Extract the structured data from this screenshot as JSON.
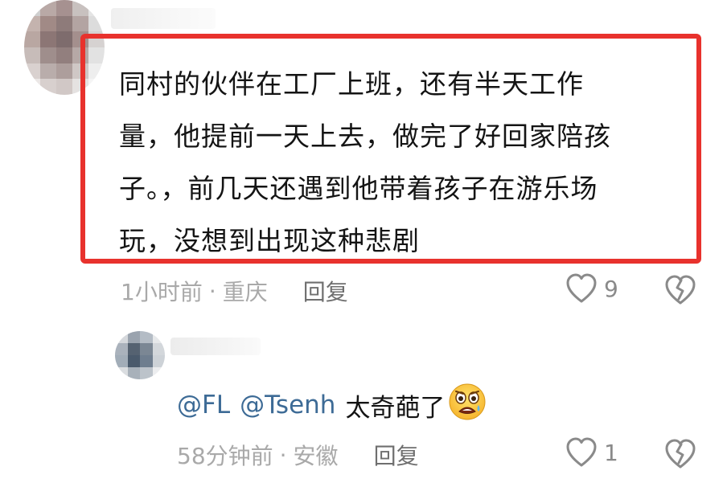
{
  "comment": {
    "lines": [
      "同村的伙伴在工厂上班，还有半天工作",
      "量，他提前一天上去，做完了好回家陪孩",
      "子。，前几天还遇到他带着孩子在游乐场",
      "玩，没想到出现这种悲剧"
    ],
    "time": "1小时前",
    "separator": "·",
    "location": "重庆",
    "reply_label": "回复",
    "like_count": "9",
    "highlight_color": "#e8322d"
  },
  "reply": {
    "mentions": [
      "@FL",
      "@Tsenh"
    ],
    "text": "太奇葩了",
    "emoji": "distressed-face-emoji",
    "time": "58分钟前",
    "separator": "·",
    "location": "安徽",
    "reply_label": "回复",
    "like_count": "1",
    "mention_color": "#3d6b96"
  },
  "icons": {
    "like": "heart-outline-icon",
    "dislike": "broken-heart-icon"
  }
}
